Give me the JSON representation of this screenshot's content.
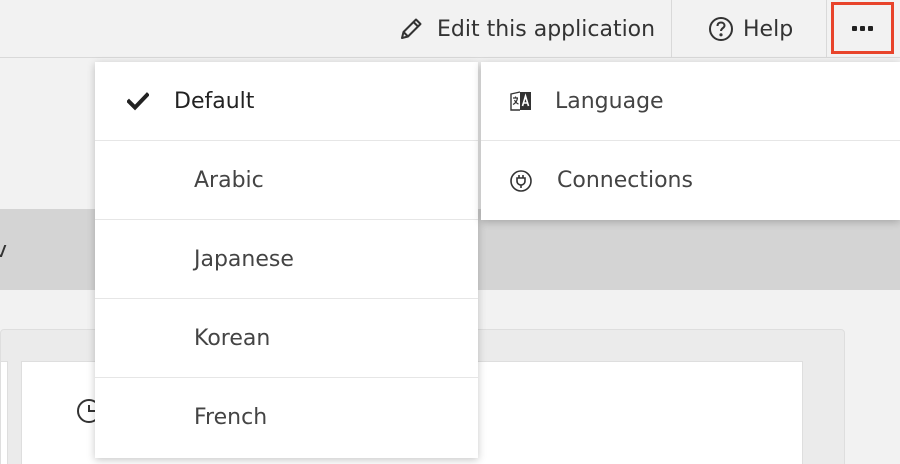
{
  "header": {
    "edit_label": "Edit this application",
    "help_label": "Help",
    "more_icon": "more-dots-icon"
  },
  "background": {
    "band_fragment": "v"
  },
  "language_menu": {
    "items": [
      {
        "label": "Default",
        "selected": true
      },
      {
        "label": "Arabic",
        "selected": false
      },
      {
        "label": "Japanese",
        "selected": false
      },
      {
        "label": "Korean",
        "selected": false
      },
      {
        "label": "French",
        "selected": false
      }
    ]
  },
  "more_menu": {
    "items": [
      {
        "label": "Language",
        "icon": "language-icon"
      },
      {
        "label": "Connections",
        "icon": "plug-icon"
      }
    ]
  },
  "colors": {
    "highlight_border": "#e8442b",
    "background": "#f2f2f2",
    "band": "#d4d4d4"
  }
}
